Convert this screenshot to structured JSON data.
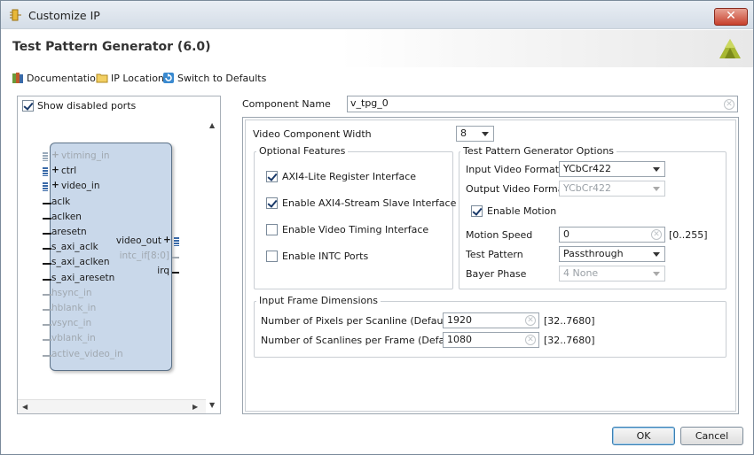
{
  "window": {
    "title": "Customize IP",
    "close_label": "✕"
  },
  "header": {
    "title": "Test Pattern Generator (6.0)"
  },
  "toolbar": {
    "documentation": "Documentation",
    "ip_location": "IP Location",
    "switch_defaults": "Switch to Defaults"
  },
  "left_panel": {
    "show_disabled_ports": "Show disabled ports",
    "show_disabled_checked": true,
    "left_ports": [
      {
        "label": "vtiming_in",
        "enabled": false,
        "bus": true
      },
      {
        "label": "ctrl",
        "enabled": true,
        "bus": true
      },
      {
        "label": "video_in",
        "enabled": true,
        "bus": true
      },
      {
        "label": "aclk",
        "enabled": true,
        "bus": false
      },
      {
        "label": "aclken",
        "enabled": true,
        "bus": false
      },
      {
        "label": "aresetn",
        "enabled": true,
        "bus": false
      },
      {
        "label": "s_axi_aclk",
        "enabled": true,
        "bus": false
      },
      {
        "label": "s_axi_aclken",
        "enabled": true,
        "bus": false
      },
      {
        "label": "s_axi_aresetn",
        "enabled": true,
        "bus": false
      },
      {
        "label": "hsync_in",
        "enabled": false,
        "bus": false
      },
      {
        "label": "hblank_in",
        "enabled": false,
        "bus": false
      },
      {
        "label": "vsync_in",
        "enabled": false,
        "bus": false
      },
      {
        "label": "vblank_in",
        "enabled": false,
        "bus": false
      },
      {
        "label": "active_video_in",
        "enabled": false,
        "bus": false
      }
    ],
    "right_ports": [
      {
        "label": "video_out",
        "enabled": true
      },
      {
        "label": "intc_if[8:0]",
        "enabled": false
      },
      {
        "label": "irq",
        "enabled": true
      }
    ]
  },
  "component": {
    "label": "Component Name",
    "value": "v_tpg_0"
  },
  "video_component_width": {
    "label": "Video Component Width",
    "value": "8"
  },
  "optional_features": {
    "title": "Optional Features",
    "items": [
      {
        "label": "AXI4-Lite Register Interface",
        "checked": true
      },
      {
        "label": "Enable AXI4-Stream Slave Interface",
        "checked": true
      },
      {
        "label": "Enable Video Timing Interface",
        "checked": false
      },
      {
        "label": "Enable INTC Ports",
        "checked": false
      }
    ]
  },
  "tpg_options": {
    "title": "Test Pattern Generator Options",
    "input_format_label": "Input Video Format",
    "input_format_value": "YCbCr422",
    "output_format_label": "Output Video Format",
    "output_format_value": "YCbCr422",
    "enable_motion_label": "Enable Motion",
    "enable_motion_checked": true,
    "motion_speed_label": "Motion Speed",
    "motion_speed_value": "0",
    "motion_speed_range": "[0..255]",
    "test_pattern_label": "Test Pattern",
    "test_pattern_value": "Passthrough",
    "bayer_phase_label": "Bayer Phase",
    "bayer_phase_value": "4 None"
  },
  "frame_dims": {
    "title": "Input Frame Dimensions",
    "pixels_label": "Number of Pixels per Scanline (Default)",
    "pixels_value": "1920",
    "pixels_range": "[32..7680]",
    "lines_label": "Number of Scanlines per Frame (Default)",
    "lines_value": "1080",
    "lines_range": "[32..7680]"
  },
  "buttons": {
    "ok": "OK",
    "cancel": "Cancel"
  },
  "colors": {
    "block_fill": "#c9d8ea",
    "close_red": "#c8402c",
    "default_button_border": "#3c7fb1"
  }
}
